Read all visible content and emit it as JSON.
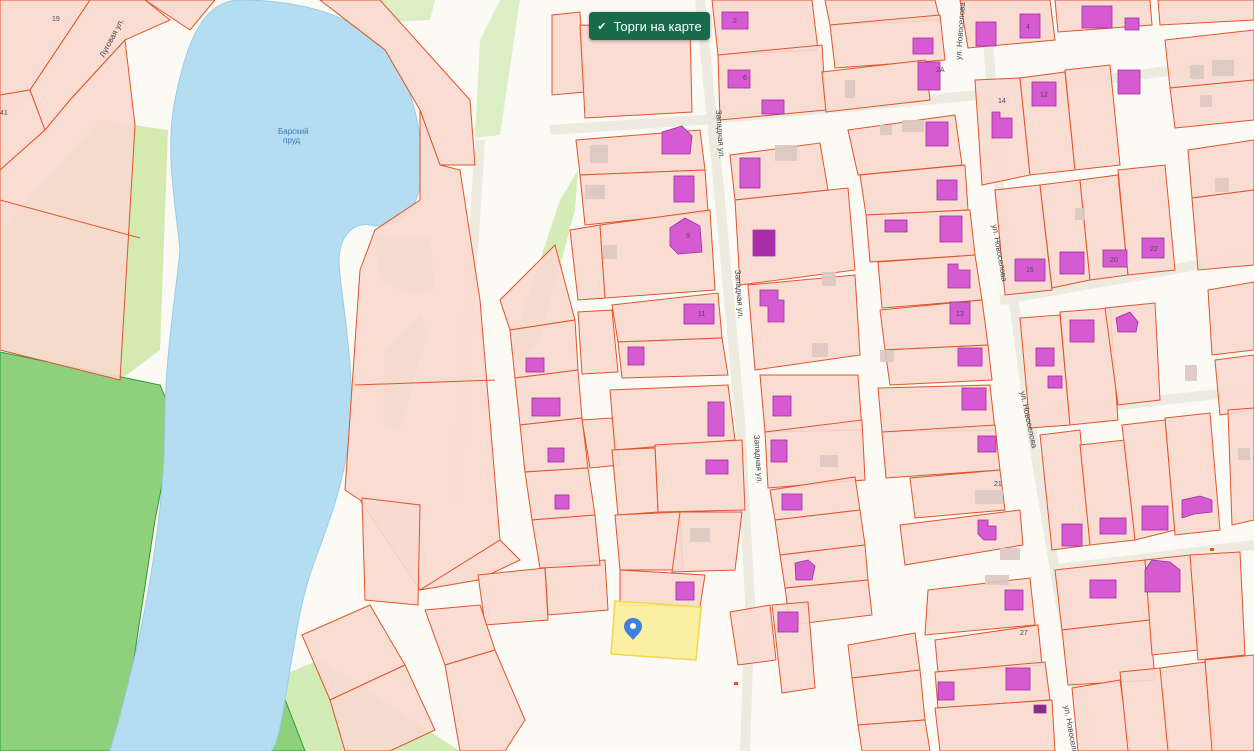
{
  "button": {
    "label": "Торги на карте",
    "icon": "check-icon"
  },
  "pond": {
    "name_line1": "Барский",
    "name_line2": "пруд"
  },
  "streets": {
    "lugovaya": "Луговая ул.",
    "zapadnaya1": "Западная ул.",
    "zapadnaya2": "Западная ул.",
    "zapadnaya3": "Западная ул.",
    "novaya1": "ул. Новоселова",
    "novaya2": "ул. Новоселова",
    "novaya3": "ул. Новоселова",
    "novaya4": "ул. Новоселова"
  },
  "house_numbers": {
    "h19": "19",
    "h41": "41",
    "h2": "2",
    "h2a": "2А",
    "h14": "14",
    "h21": "21",
    "h27": "27",
    "h4": "4",
    "h6": "6",
    "h9": "9",
    "h11": "11",
    "h12": "12",
    "h13": "13",
    "h16": "16",
    "h20": "20",
    "h22": "22"
  },
  "colors": {
    "parcel_fill": "#f8d9cf",
    "parcel_stroke": "#e0542c",
    "building": "#d65bd2",
    "water": "#b5ddf2",
    "forest": "#8fd07c",
    "selected_parcel": "#fbee98",
    "button_bg": "#176b4c",
    "marker": "#3e7fe0"
  },
  "marker": {
    "icon": "map-pin-icon"
  }
}
